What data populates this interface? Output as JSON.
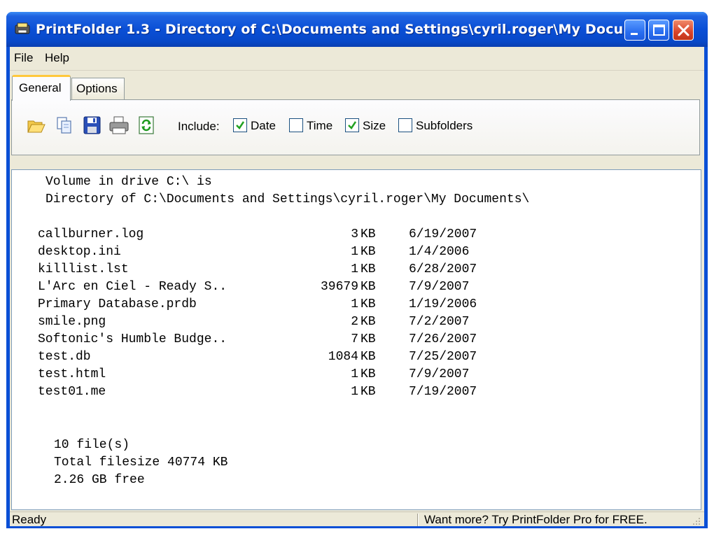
{
  "window": {
    "title": "PrintFolder 1.3 - Directory of C:\\Documents and Settings\\cyril.roger\\My Docu…"
  },
  "menu": {
    "file": "File",
    "help": "Help"
  },
  "tabs": {
    "general": "General",
    "options": "Options"
  },
  "toolbar": {
    "icons": [
      "open-folder-icon",
      "copy-icon",
      "save-icon",
      "print-icon",
      "refresh-icon"
    ],
    "include_label": "Include:",
    "options": [
      {
        "label": "Date",
        "checked": true
      },
      {
        "label": "Time",
        "checked": false
      },
      {
        "label": "Size",
        "checked": true
      },
      {
        "label": "Subfolders",
        "checked": false
      }
    ]
  },
  "output": {
    "header_line1": "Volume in drive C:\\ is",
    "header_line2": "Directory of C:\\Documents and Settings\\cyril.roger\\My Documents\\",
    "files": [
      {
        "name": "callburner.log",
        "size": "3",
        "unit": "KB",
        "date": "6/19/2007"
      },
      {
        "name": "desktop.ini",
        "size": "1",
        "unit": "KB",
        "date": "1/4/2006"
      },
      {
        "name": "killlist.lst",
        "size": "1",
        "unit": "KB",
        "date": "6/28/2007"
      },
      {
        "name": "L'Arc en Ciel - Ready S..",
        "size": "39679",
        "unit": "KB",
        "date": "7/9/2007"
      },
      {
        "name": "Primary Database.prdb",
        "size": "1",
        "unit": "KB",
        "date": "1/19/2006"
      },
      {
        "name": "smile.png",
        "size": "2",
        "unit": "KB",
        "date": "7/2/2007"
      },
      {
        "name": "Softonic's Humble Budge..",
        "size": "7",
        "unit": "KB",
        "date": "7/26/2007"
      },
      {
        "name": "test.db",
        "size": "1084",
        "unit": "KB",
        "date": "7/25/2007"
      },
      {
        "name": "test.html",
        "size": "1",
        "unit": "KB",
        "date": "7/9/2007"
      },
      {
        "name": "test01.me",
        "size": "1",
        "unit": "KB",
        "date": "7/19/2007"
      }
    ],
    "summary_count": "10 file(s)",
    "summary_total": "Total filesize 40774 KB",
    "summary_free": "2.26 GB free"
  },
  "status": {
    "left": "Ready",
    "right": "Want more? Try PrintFolder Pro for FREE."
  },
  "colors": {
    "titlebar": "#0a4fd6",
    "face": "#ece9d8",
    "tab_highlight": "#ffc83c",
    "checkmark": "#21a121"
  }
}
